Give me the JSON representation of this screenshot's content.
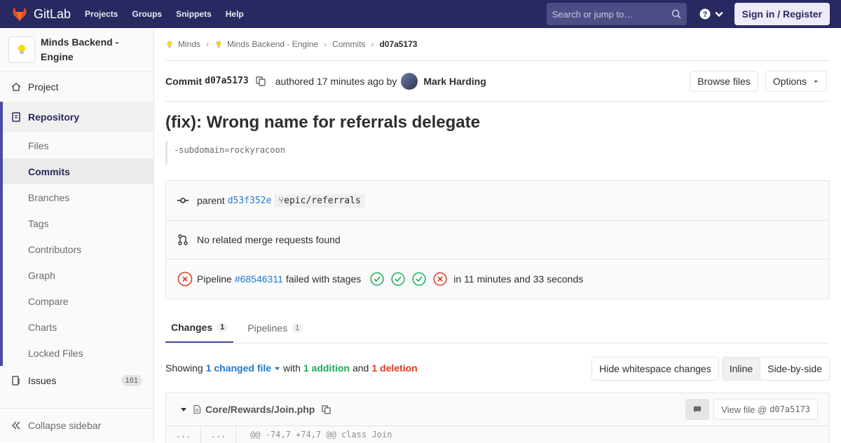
{
  "navbar": {
    "brand": "GitLab",
    "links": [
      "Projects",
      "Groups",
      "Snippets",
      "Help"
    ],
    "search_placeholder": "Search or jump to…",
    "signin_label": "Sign in / Register"
  },
  "sidebar": {
    "project_name": "Minds Backend - Engine",
    "project_label": "Project",
    "repository_label": "Repository",
    "repo_items": [
      "Files",
      "Commits",
      "Branches",
      "Tags",
      "Contributors",
      "Graph",
      "Compare",
      "Charts",
      "Locked Files"
    ],
    "issues_label": "Issues",
    "issues_count": "161",
    "collapse_label": "Collapse sidebar"
  },
  "breadcrumbs": {
    "group": "Minds",
    "project": "Minds Backend - Engine",
    "section": "Commits",
    "current": "d07a5173"
  },
  "commit": {
    "label": "Commit",
    "sha": "d07a5173",
    "authored": "authored 17 minutes ago by",
    "author": "Mark Harding",
    "browse_label": "Browse files",
    "options_label": "Options",
    "title": "(fix): Wrong name for referrals delegate",
    "description": "-subdomain=rockyracoon",
    "parent_label": "parent",
    "parent_sha": "d53f352e",
    "branch": "epic/referrals",
    "merge_requests": "No related merge requests found",
    "pipeline_prefix": "Pipeline",
    "pipeline_id": "#68546311",
    "pipeline_status": "failed with stages",
    "pipeline_duration": "in 11 minutes and 33 seconds"
  },
  "tabs": {
    "changes_label": "Changes",
    "changes_count": "1",
    "pipelines_label": "Pipelines",
    "pipelines_count": "1"
  },
  "diff_summary": {
    "showing": "Showing",
    "changed": "1 changed file",
    "with": "with",
    "additions": "1 addition",
    "and": "and",
    "deletions": "1 deletion",
    "hide_ws_label": "Hide whitespace changes",
    "inline_label": "Inline",
    "side_label": "Side-by-side"
  },
  "file": {
    "path": "Core/Rewards/Join.php",
    "view_label": "View file @",
    "view_sha": "d07a5173",
    "old_ln": "...",
    "new_ln": "...",
    "hunk": "@@ -74,7 +74,7 @@ class Join"
  },
  "colors": {
    "navbar": "#292961",
    "success": "#1aaa55",
    "failure": "#db3b21",
    "link": "#1f78d1"
  },
  "icons": [
    "gitlab-logo-icon",
    "search-icon",
    "help-icon",
    "copy-icon",
    "commit-icon",
    "merge-request-icon",
    "pipeline-failed-icon",
    "stage-success-icon",
    "stage-failed-icon",
    "file-icon",
    "comment-icon"
  ]
}
